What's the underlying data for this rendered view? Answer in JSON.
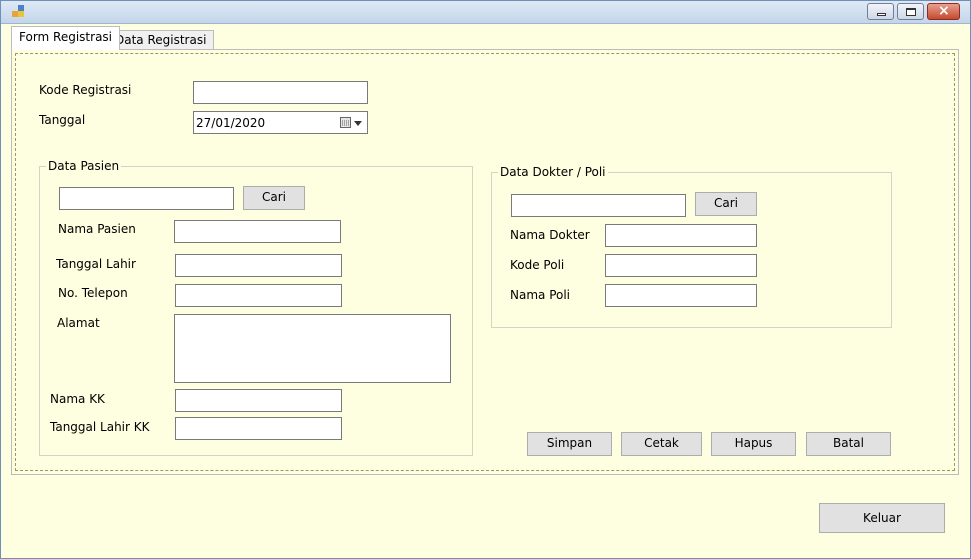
{
  "window": {
    "title": ""
  },
  "tabs": [
    {
      "label": "Form Registrasi"
    },
    {
      "label": "Data Registrasi"
    }
  ],
  "form": {
    "kode_registrasi_label": "Kode Registrasi",
    "kode_registrasi_value": "",
    "tanggal_label": "Tanggal",
    "tanggal_value": "27/01/2020"
  },
  "pasien": {
    "group_title": "Data Pasien",
    "search_value": "",
    "cari_label": "Cari",
    "nama_label": "Nama Pasien",
    "tgl_lahir_label": "Tanggal Lahir",
    "telepon_label": "No. Telepon",
    "alamat_label": "Alamat",
    "nama_kk_label": "Nama KK",
    "tgl_lahir_kk_label": "Tanggal Lahir KK"
  },
  "dokter": {
    "group_title": "Data Dokter / Poli",
    "search_value": "",
    "cari_label": "Cari",
    "nama_dokter_label": "Nama Dokter",
    "kode_poli_label": "Kode Poli",
    "nama_poli_label": "Nama Poli"
  },
  "actions": {
    "simpan": "Simpan",
    "cetak": "Cetak",
    "hapus": "Hapus",
    "batal": "Batal",
    "keluar": "Keluar"
  },
  "colors": {
    "form_background": "#fefee0",
    "button_face": "#e1e1e1",
    "close_button": "#c54a30"
  }
}
